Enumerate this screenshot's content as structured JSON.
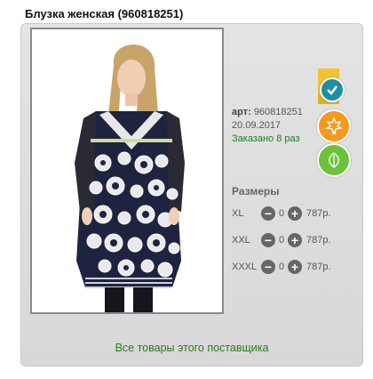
{
  "product": {
    "title": "Блузка женская (960818251)",
    "article_label": "арт:",
    "article": "960818251",
    "date": "20.09.2017",
    "ordered": "Заказано 8 раз"
  },
  "sizes": {
    "title": "Размеры",
    "rows": [
      {
        "name": "XL",
        "qty": "0",
        "price": "787р."
      },
      {
        "name": "XXL",
        "qty": "0",
        "price": "787р."
      },
      {
        "name": "XXXL",
        "qty": "0",
        "price": "787р."
      }
    ],
    "minus": "−",
    "plus": "+"
  },
  "footer": {
    "supplier_link": "Все товары этого поставщика"
  },
  "badges": {
    "flag_color": "#f2c230",
    "check_color": "#1e8fa3",
    "leaf_maple_color": "#f39a1e",
    "leaf_green_color": "#6cc23a"
  },
  "badge_icons": [
    "check-icon",
    "maple-leaf-icon",
    "leaf-icon"
  ]
}
